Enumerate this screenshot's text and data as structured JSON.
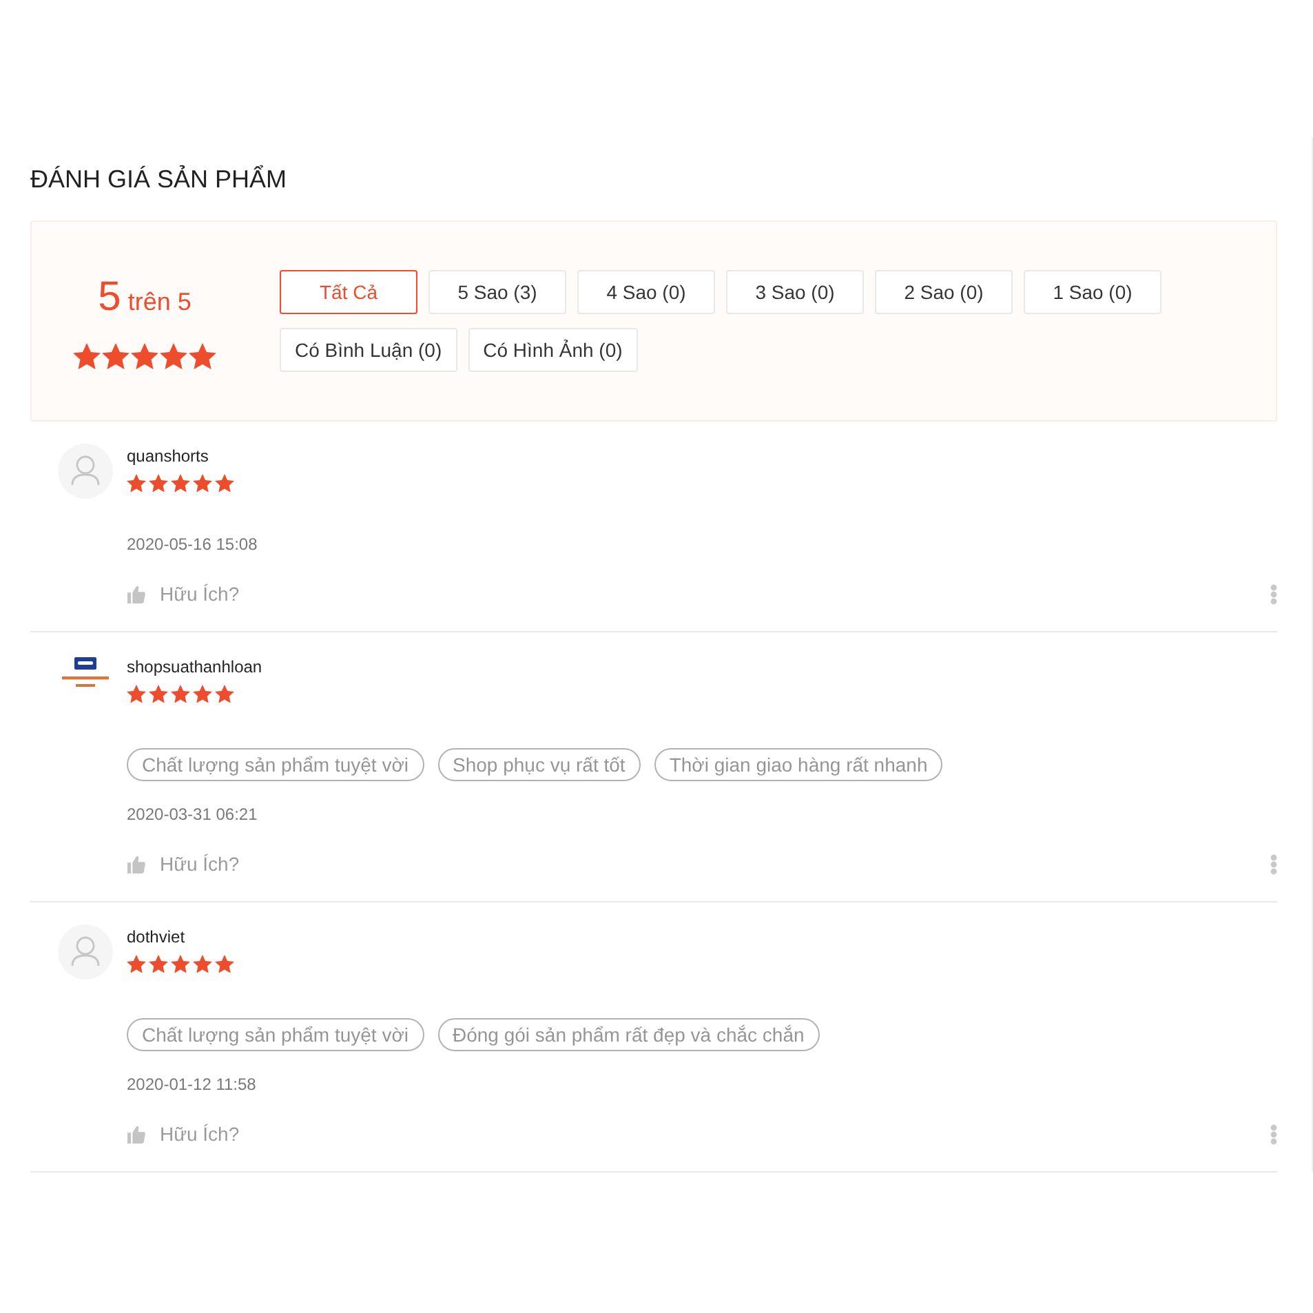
{
  "title": "ĐÁNH GIÁ SẢN PHẨM",
  "summary": {
    "score": "5",
    "score_suffix": "trên 5",
    "stars": 5,
    "filters": [
      {
        "label": "Tất Cả",
        "selected": true
      },
      {
        "label": "5 Sao (3)",
        "selected": false
      },
      {
        "label": "4 Sao (0)",
        "selected": false
      },
      {
        "label": "3 Sao (0)",
        "selected": false
      },
      {
        "label": "2 Sao (0)",
        "selected": false
      },
      {
        "label": "1 Sao (0)",
        "selected": false
      },
      {
        "label": "Có Bình Luận (0)",
        "selected": false
      },
      {
        "label": "Có Hình Ảnh (0)",
        "selected": false
      }
    ]
  },
  "reviews": [
    {
      "kind": "user",
      "username": "quanshorts",
      "stars": 5,
      "date": "2020-05-16 15:08",
      "helpful_label": "Hữu Ích?"
    },
    {
      "kind": "shop",
      "username": "shopsuathanhloan",
      "stars": 5,
      "tags": [
        "Chất lượng sản phẩm tuyệt vời",
        "Shop phục vụ rất tốt",
        "Thời gian giao hàng rất nhanh"
      ],
      "date": "2020-03-31 06:21",
      "helpful_label": "Hữu Ích?"
    },
    {
      "kind": "user",
      "username": "dothviet",
      "stars": 5,
      "tags": [
        "Chất lượng sản phẩm tuyệt vời",
        "Đóng gói sản phẩm rất đẹp và chắc chắn"
      ],
      "date": "2020-01-12 11:58",
      "helpful_label": "Hữu Ích?"
    }
  ]
}
